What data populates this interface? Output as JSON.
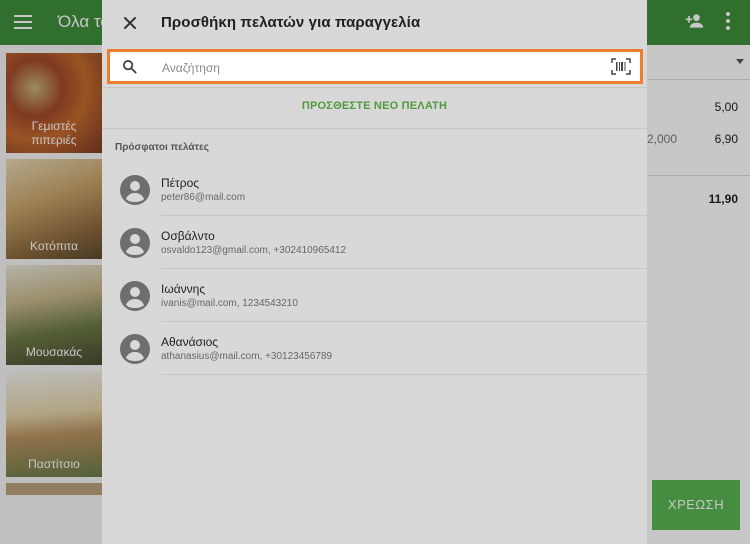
{
  "app": {
    "title": "Όλα τα",
    "tiles": [
      {
        "label": "Γεμιστές\nπιπεριές",
        "color": "#9e4a2f"
      },
      {
        "label": "Κοτόπιτα",
        "color": "#8d6b42"
      },
      {
        "label": "Μουσακάς",
        "color": "#6e7a52"
      },
      {
        "label": "Παστίτσιο",
        "color": "#8c7c55"
      }
    ],
    "right_panel": {
      "lines": [
        {
          "qty": "",
          "value": "5,00"
        },
        {
          "qty": "2,000",
          "value": "6,90"
        }
      ],
      "total": "11,90",
      "charge_label": "ΧΡΕΩΣΗ"
    }
  },
  "dialog": {
    "title": "Προσθήκη πελατών για παραγγελία",
    "search_placeholder": "Αναζήτηση",
    "new_customer_label": "ΠΡΟΣΘΕΣΤΕ ΝΕΟ ΠΕΛΑΤΗ",
    "recent_label": "Πρόσφατοι πελάτες",
    "customers": [
      {
        "name": "Πέτρος",
        "info": "peter86@mail.com"
      },
      {
        "name": "Οσβάλντο",
        "info": "osvaldo123@gmail.com, +302410965412"
      },
      {
        "name": "Ιωάννης",
        "info": "ivanis@mail.com, 1234543210"
      },
      {
        "name": "Αθανάσιος",
        "info": "athanasius@mail.com, +30123456789"
      }
    ]
  },
  "colors": {
    "accent_green": "#3f8f3b",
    "search_border": "#ef7d2f",
    "link_green": "#4e9a3e"
  }
}
